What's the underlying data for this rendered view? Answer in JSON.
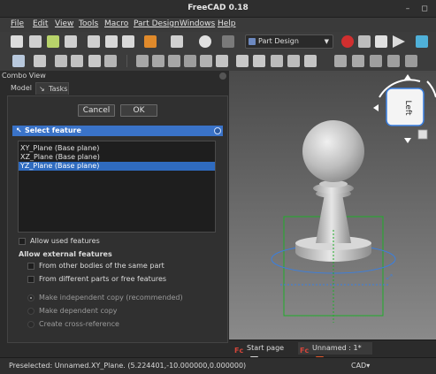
{
  "window": {
    "title": "FreeCAD 0.18",
    "minimize": "–",
    "maximize": "◻"
  },
  "menu": {
    "items": [
      "File",
      "Edit",
      "View",
      "Tools",
      "Macro",
      "Part Design",
      "Windows",
      "Help"
    ]
  },
  "toolbar": {
    "workbench": "Part Design"
  },
  "combo_view": {
    "title": "Combo View",
    "tabs": [
      "Model",
      "Tasks"
    ],
    "active_tab": "Tasks"
  },
  "dialog": {
    "cancel_label": "Cancel",
    "ok_label": "OK",
    "section_title": "Select feature",
    "features": [
      "XY_Plane (Base plane)",
      "XZ_Plane (Base plane)",
      "YZ_Plane (Base plane)"
    ],
    "selected_feature": "YZ_Plane (Base plane)",
    "allow_used_features": "Allow used features",
    "allow_external": "Allow external features",
    "from_other_bodies": "From other bodies of the same part",
    "from_different_parts": "From different parts or free features",
    "radio_independent": "Make independent copy (recommended)",
    "radio_dependent": "Make dependent copy",
    "radio_crossref": "Create cross-reference"
  },
  "navcube": {
    "face_label": "Left"
  },
  "viewport_tabs": [
    {
      "label": "Start page"
    },
    {
      "label": "Unnamed : 1*"
    }
  ],
  "status": {
    "text": "Preselected: Unnamed.XY_Plane. (5.224401,-10.000000,0.000000)",
    "nav_style": "CAD▾"
  },
  "colors": {
    "accent_blue": "#3a73c8",
    "selection_blue": "#2f6bbf",
    "bounding_box_green": "#1fae2a",
    "record_red": "#d12f2f"
  }
}
